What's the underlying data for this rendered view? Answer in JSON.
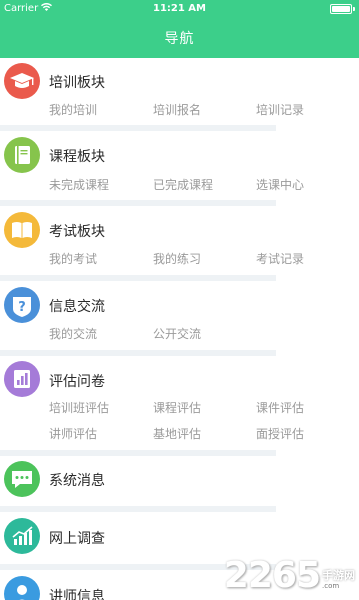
{
  "status_bar": {
    "carrier": "Carrier",
    "time": "11:21 AM"
  },
  "nav": {
    "title": "导航"
  },
  "sections": [
    {
      "title": "培训板块",
      "icon": "graduation-cap-icon",
      "color": "#ea5a4c",
      "items": [
        "我的培训",
        "培训报名",
        "培训记录"
      ]
    },
    {
      "title": "课程板块",
      "icon": "course-book-icon",
      "color": "#86c44c",
      "items": [
        "未完成课程",
        "已完成课程",
        "选课中心"
      ]
    },
    {
      "title": "考试板块",
      "icon": "exam-book-icon",
      "color": "#f4b93a",
      "items": [
        "我的考试",
        "我的练习",
        "考试记录"
      ]
    },
    {
      "title": "信息交流",
      "icon": "question-shield-icon",
      "color": "#4a90d9",
      "items": [
        "我的交流",
        "公开交流"
      ]
    },
    {
      "title": "评估问卷",
      "icon": "bar-chart-icon",
      "color": "#a57bd8",
      "items": [
        "培训班评估",
        "课程评估",
        "课件评估",
        "讲师评估",
        "基地评估",
        "面授评估"
      ]
    },
    {
      "title": "系统消息",
      "icon": "message-bubble-icon",
      "color": "#4cc35b",
      "items": []
    },
    {
      "title": "网上调查",
      "icon": "survey-chart-icon",
      "color": "#2db99a",
      "items": []
    },
    {
      "title": "讲师信息",
      "icon": "teacher-icon",
      "color": "#3a9be0",
      "items": []
    }
  ],
  "watermark": {
    "number": "2265",
    "site_cn": "手游网",
    "url": ".com"
  }
}
